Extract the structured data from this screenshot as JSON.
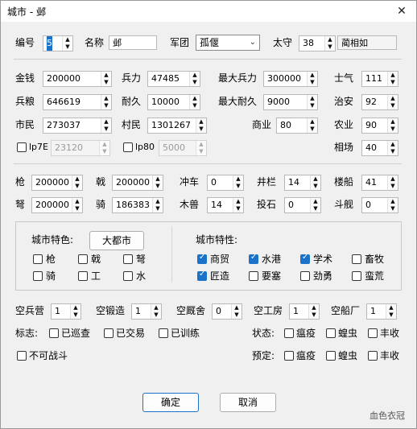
{
  "window": {
    "title": "城市 - 邺",
    "close": "✕"
  },
  "top": {
    "id_label": "编号",
    "id_value": "5",
    "name_label": "名称",
    "name_value": "邺",
    "army_label": "军团",
    "army_value": "孤偃",
    "guard_label": "太守",
    "guard_value": "38",
    "guard_name": "蔺相如"
  },
  "stats": [
    {
      "key": "gold",
      "label": "金钱",
      "value": "200000"
    },
    {
      "key": "troops",
      "label": "兵力",
      "value": "47485"
    },
    {
      "key": "max_troops",
      "label": "最大兵力",
      "value": "300000"
    },
    {
      "key": "morale",
      "label": "士气",
      "value": "111"
    },
    {
      "key": "food",
      "label": "兵粮",
      "value": "646619"
    },
    {
      "key": "durability",
      "label": "耐久",
      "value": "10000"
    },
    {
      "key": "max_durability",
      "label": "最大耐久",
      "value": "9000"
    },
    {
      "key": "order",
      "label": "治安",
      "value": "92"
    },
    {
      "key": "citizens",
      "label": "市民",
      "value": "273037"
    },
    {
      "key": "villagers",
      "label": "村民",
      "value": "1301267"
    },
    {
      "key": "commerce",
      "label": "商业",
      "value": "80"
    },
    {
      "key": "agriculture",
      "label": "农业",
      "value": "90"
    }
  ],
  "disabled": {
    "lp7e_label": "lp7E",
    "lp7e_value": "23120",
    "lp80_label": "lp80",
    "lp80_value": "5000",
    "market_label": "相场",
    "market_value": "40"
  },
  "weapons": [
    {
      "label": "枪",
      "value": "200000"
    },
    {
      "label": "戟",
      "value": "200000"
    },
    {
      "label": "冲车",
      "value": "0"
    },
    {
      "label": "井栏",
      "value": "14"
    },
    {
      "label": "楼船",
      "value": "41"
    },
    {
      "label": "弩",
      "value": "200000"
    },
    {
      "label": "骑",
      "value": "186383"
    },
    {
      "label": "木兽",
      "value": "14"
    },
    {
      "label": "投石",
      "value": "0"
    },
    {
      "label": "斗舰",
      "value": "0"
    }
  ],
  "features": {
    "specialty_label": "城市特色:",
    "specialty_value": "大都市",
    "specialty_items": [
      {
        "label": "枪",
        "checked": false
      },
      {
        "label": "戟",
        "checked": false
      },
      {
        "label": "弩",
        "checked": false
      },
      {
        "label": "骑",
        "checked": false
      },
      {
        "label": "工",
        "checked": false
      },
      {
        "label": "水",
        "checked": false
      }
    ],
    "traits_label": "城市特性:",
    "traits": [
      {
        "label": "商贸",
        "checked": true
      },
      {
        "label": "水港",
        "checked": true
      },
      {
        "label": "学术",
        "checked": true
      },
      {
        "label": "畜牧",
        "checked": false
      },
      {
        "label": "匠造",
        "checked": true
      },
      {
        "label": "要塞",
        "checked": false
      },
      {
        "label": "劲勇",
        "checked": false
      },
      {
        "label": "蛮荒",
        "checked": false
      }
    ]
  },
  "facilities": [
    {
      "label": "空兵营",
      "value": "1"
    },
    {
      "label": "空锻造",
      "value": "1"
    },
    {
      "label": "空厩舍",
      "value": "0"
    },
    {
      "label": "空工房",
      "value": "1"
    },
    {
      "label": "空船厂",
      "value": "1"
    }
  ],
  "flags": {
    "label": "标志:",
    "items": [
      {
        "label": "已巡查",
        "checked": false
      },
      {
        "label": "已交易",
        "checked": false
      },
      {
        "label": "已训练",
        "checked": false
      }
    ],
    "nofight": "不可战斗"
  },
  "status": {
    "label": "状态:",
    "items": [
      {
        "label": "瘟疫",
        "checked": false
      },
      {
        "label": "蝗虫",
        "checked": false
      },
      {
        "label": "丰收",
        "checked": false
      }
    ]
  },
  "forecast": {
    "label": "预定:",
    "items": [
      {
        "label": "瘟疫",
        "checked": false
      },
      {
        "label": "蝗虫",
        "checked": false
      },
      {
        "label": "丰收",
        "checked": false
      }
    ]
  },
  "buttons": {
    "ok": "确定",
    "cancel": "取消"
  },
  "watermark": "血色衣冠"
}
